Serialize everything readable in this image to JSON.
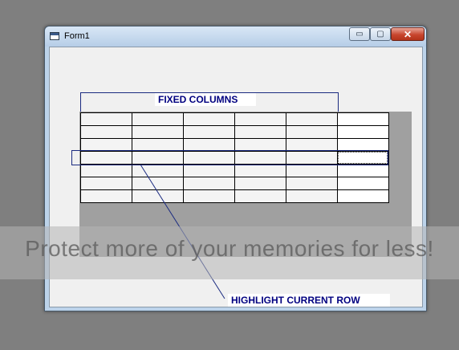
{
  "window": {
    "title": "Form1",
    "minimize_glyph": "▭",
    "maximize_glyph": "▢",
    "close_glyph": "✕"
  },
  "annotations": {
    "fixed_columns": "FIXED COLUMNS",
    "highlight_row": "HIGHLIGHT CURRENT ROW"
  },
  "grid": {
    "rows": 7,
    "columns": 6,
    "fixed_columns": 5,
    "highlighted_row": 3
  },
  "watermark": {
    "text": "Protect more of your memories for less!"
  },
  "colors": {
    "annotation_text": "#000080",
    "annotation_line": "#1a2a80"
  }
}
